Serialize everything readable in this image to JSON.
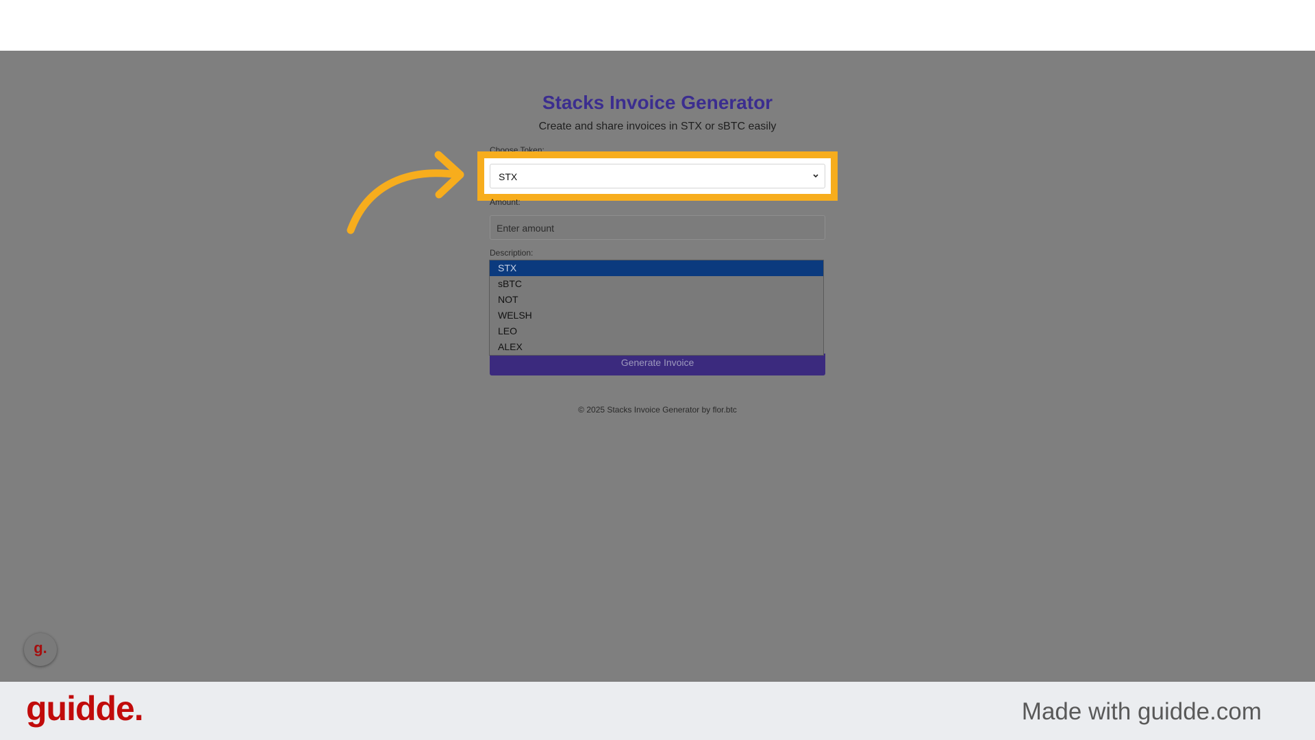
{
  "app": {
    "title": "Stacks Invoice Generator",
    "subtitle": "Create and share invoices in STX or sBTC easily"
  },
  "form": {
    "token_label": "Choose Token:",
    "token_selected": "STX",
    "amount_label": "Amount:",
    "amount_placeholder": "Enter amount",
    "description_label": "Description:",
    "submit_label": "Generate Invoice"
  },
  "token_options": [
    "STX",
    "sBTC",
    "NOT",
    "WELSH",
    "LEO",
    "ALEX"
  ],
  "footer": {
    "copyright": "© 2025 Stacks Invoice Generator by flor.btc"
  },
  "branding": {
    "badge": "g.",
    "logo": "guidde.",
    "made_with": "Made with guidde.com"
  },
  "colors": {
    "highlight": "#f7ad1d",
    "title": "#3b2d8f",
    "selected_option": "#0b3a7e",
    "button": "#3b2a7e",
    "brand": "#c10b0b"
  },
  "icons": {
    "select_caret": "chevron-down-icon",
    "pointer": "curved-arrow-icon"
  }
}
